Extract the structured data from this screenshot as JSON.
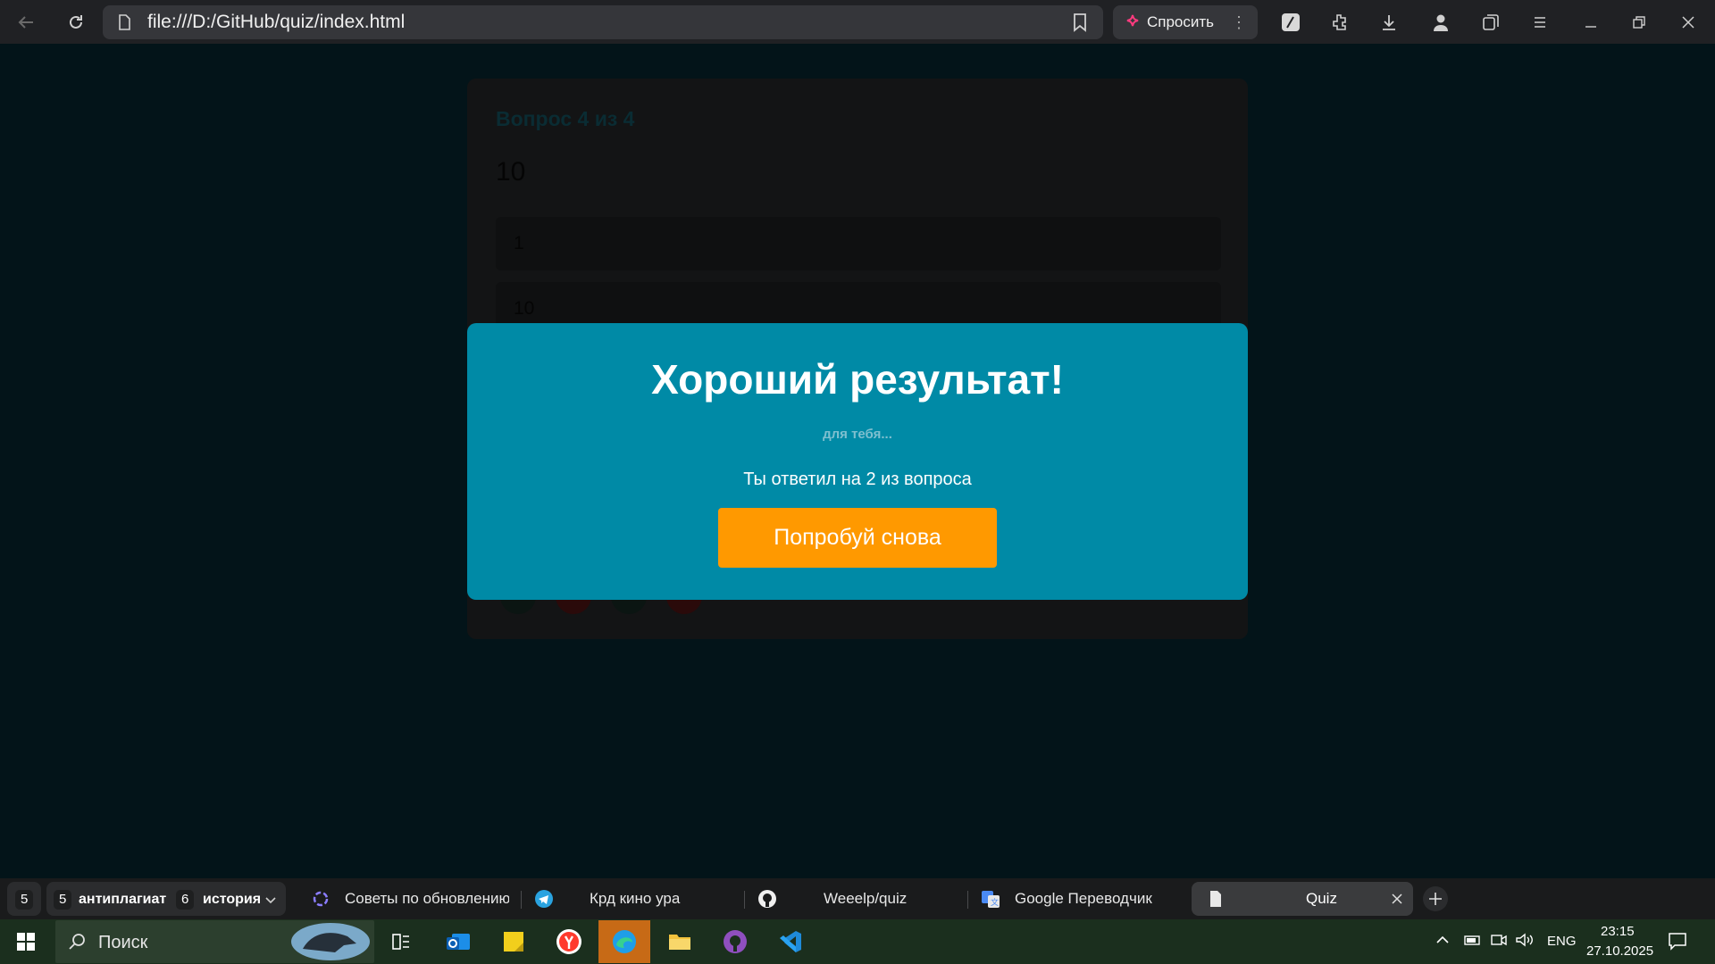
{
  "browser": {
    "url": "file:///D:/GitHub/quiz/index.html",
    "ask_label": "Спросить",
    "icons": [
      "back-icon",
      "reload-icon",
      "bookmark-icon",
      "extension-icon",
      "download-icon",
      "profile-icon",
      "collections-icon",
      "menu-icon",
      "minimize-icon",
      "restore-icon",
      "close-icon"
    ]
  },
  "quiz": {
    "counter": "Вопрос 4 из 4",
    "question": "10",
    "options": [
      "1",
      "10"
    ]
  },
  "modal": {
    "title": "Хороший результат!",
    "subtitle": "для тебя...",
    "result": "Ты ответил на 2 из вопроса",
    "retry_label": "Попробуй снова"
  },
  "tabs": {
    "group_count": "5",
    "groups": [
      {
        "count": "5",
        "name": "антиплагиат"
      },
      {
        "count": "6",
        "name": "история"
      }
    ],
    "items": [
      {
        "label": "Советы по обновлению н",
        "icon": "openai-icon"
      },
      {
        "label": "Крд кино ура",
        "icon": "telegram-icon"
      },
      {
        "label": "Weeelp/quiz",
        "icon": "github-icon"
      },
      {
        "label": "Google Переводчик",
        "icon": "translate-icon"
      },
      {
        "label": "Quiz",
        "icon": "document-icon"
      }
    ]
  },
  "taskbar": {
    "search_placeholder": "Поиск",
    "lang": "ENG",
    "time": "23:15",
    "date": "27.10.2025"
  },
  "colors": {
    "page_bg": "#031419",
    "modal_bg": "#008aa6",
    "retry_button": "#ff9900"
  }
}
